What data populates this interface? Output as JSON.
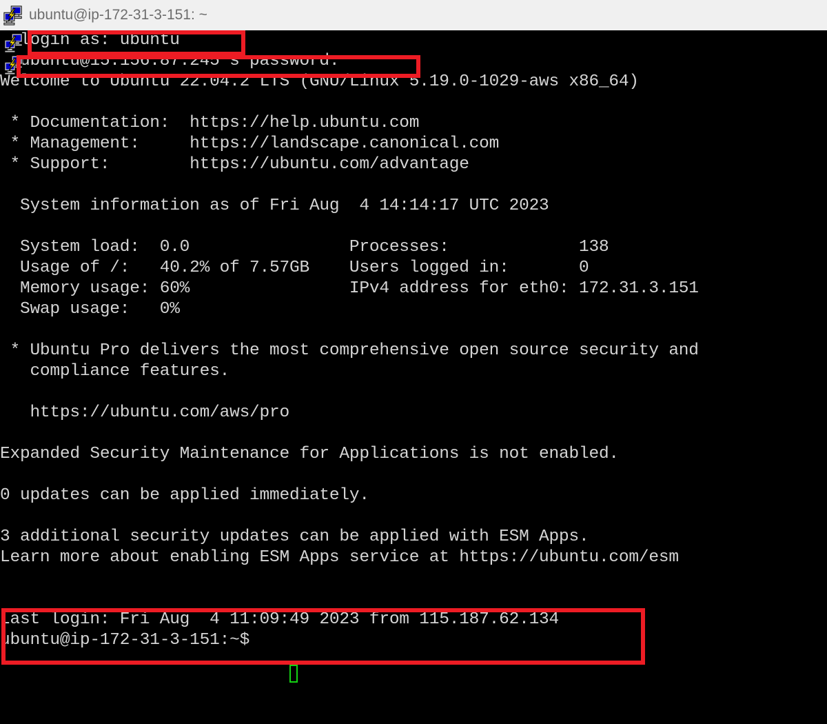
{
  "window": {
    "title": "ubuntu@ip-172-31-3-151: ~",
    "icon": "putty-icon",
    "titlebar_bg": "#f0f0f0",
    "titlebar_text_color": "#6d6d6d"
  },
  "terminal": {
    "bg_color": "#000000",
    "text_color": "#d4d4d4",
    "cursor_color": "#14d214",
    "lines": [
      "  login as: ubuntu",
      "  ubuntu@15.156.87.245's password:",
      "Welcome to Ubuntu 22.04.2 LTS (GNU/Linux 5.19.0-1029-aws x86_64)",
      "",
      " * Documentation:  https://help.ubuntu.com",
      " * Management:     https://landscape.canonical.com",
      " * Support:        https://ubuntu.com/advantage",
      "",
      "  System information as of Fri Aug  4 14:14:17 UTC 2023",
      "",
      "  System load:  0.0                Processes:             138",
      "  Usage of /:   40.2% of 7.57GB    Users logged in:       0",
      "  Memory usage: 60%                IPv4 address for eth0: 172.31.3.151",
      "  Swap usage:   0%",
      "",
      " * Ubuntu Pro delivers the most comprehensive open source security and",
      "   compliance features.",
      "",
      "   https://ubuntu.com/aws/pro",
      "",
      "Expanded Security Maintenance for Applications is not enabled.",
      "",
      "0 updates can be applied immediately.",
      "",
      "3 additional security updates can be applied with ESM Apps.",
      "Learn more about enabling ESM Apps service at https://ubuntu.com/esm",
      "",
      "",
      "Last login: Fri Aug  4 11:09:49 2023 from 115.187.62.134",
      "ubuntu@ip-172-31-3-151:~$ "
    ],
    "login_prompt": "login as: ubuntu",
    "password_prompt": "ubuntu@15.156.87.245's password:",
    "welcome": "Welcome to Ubuntu 22.04.2 LTS (GNU/Linux 5.19.0-1029-aws x86_64)",
    "links": {
      "documentation_label": "* Documentation:",
      "documentation_url": "https://help.ubuntu.com",
      "management_label": "* Management:",
      "management_url": "https://landscape.canonical.com",
      "support_label": "* Support:",
      "support_url": "https://ubuntu.com/advantage"
    },
    "system_info": {
      "heading": "System information as of Fri Aug  4 14:14:17 UTC 2023",
      "system_load": "0.0",
      "usage_of_root": "40.2% of 7.57GB",
      "memory_usage": "60%",
      "swap_usage": "0%",
      "processes": "138",
      "users_logged_in": "0",
      "ipv4_address_eth0": "172.31.3.151"
    },
    "pro_notice_line1": "* Ubuntu Pro delivers the most comprehensive open source security and",
    "pro_notice_line2": "compliance features.",
    "pro_url": "https://ubuntu.com/aws/pro",
    "esm_not_enabled": "Expanded Security Maintenance for Applications is not enabled.",
    "updates_available": "0 updates can be applied immediately.",
    "esm_updates": "3 additional security updates can be applied with ESM Apps.",
    "esm_learn_more": "Learn more about enabling ESM Apps service at https://ubuntu.com/esm",
    "last_login": "Last login: Fri Aug  4 11:09:49 2023 from 115.187.62.134",
    "prompt": "ubuntu@ip-172-31-3-151:~$ "
  },
  "annotations": {
    "color": "#ed1c24",
    "boxes": [
      {
        "name": "login-as-highlight"
      },
      {
        "name": "password-prompt-highlight"
      },
      {
        "name": "shell-prompt-highlight"
      }
    ]
  }
}
